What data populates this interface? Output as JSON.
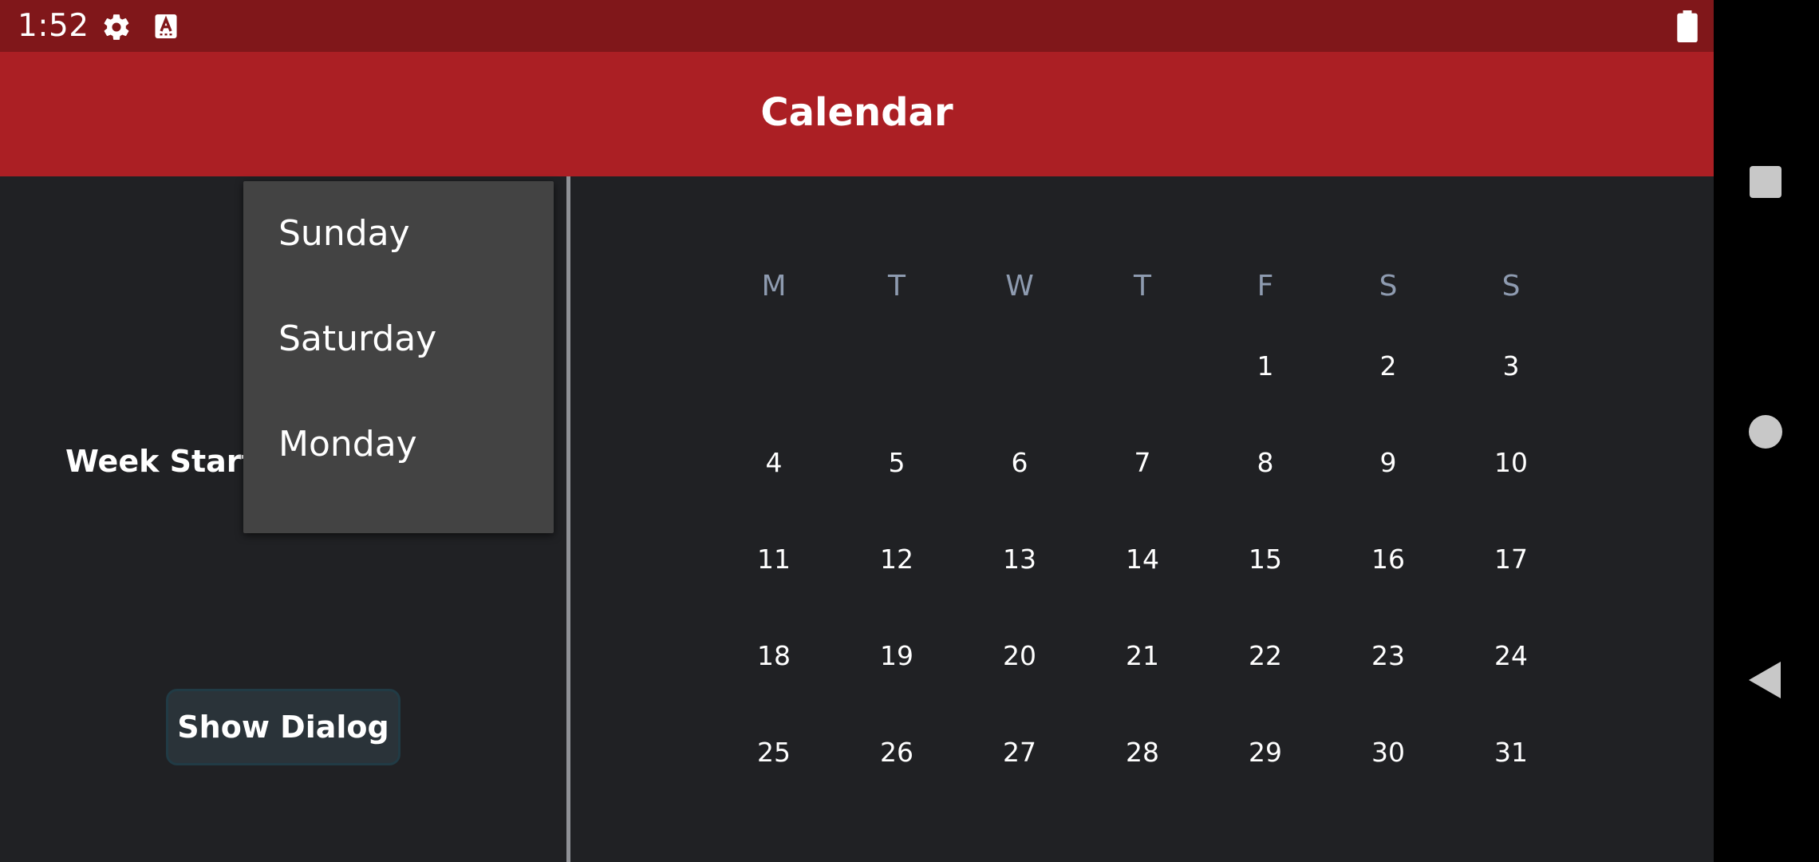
{
  "status_bar": {
    "time": "1:52",
    "icons": [
      "settings-icon",
      "accessibility-font-icon",
      "battery-icon"
    ]
  },
  "app_bar": {
    "title": "Calendar"
  },
  "settings": {
    "week_start_label": "Week Start:",
    "week_start_options": [
      "Sunday",
      "Saturday",
      "Monday"
    ],
    "show_dialog_label": "Show Dialog"
  },
  "calendar": {
    "weekday_headers": [
      "M",
      "T",
      "W",
      "T",
      "F",
      "S",
      "S"
    ],
    "first_day_column": 4,
    "days": [
      "1",
      "2",
      "3",
      "4",
      "5",
      "6",
      "7",
      "8",
      "9",
      "10",
      "11",
      "12",
      "13",
      "14",
      "15",
      "16",
      "17",
      "18",
      "19",
      "20",
      "21",
      "22",
      "23",
      "24",
      "25",
      "26",
      "27",
      "28",
      "29",
      "30",
      "31"
    ]
  },
  "colors": {
    "status_bar": "#80171a",
    "app_bar": "#ab1f24",
    "background": "#202124",
    "dropdown": "#434343",
    "weekday_header": "#8e9bb0"
  },
  "navigation": {
    "buttons": [
      "recents-button",
      "home-button",
      "back-button"
    ]
  }
}
